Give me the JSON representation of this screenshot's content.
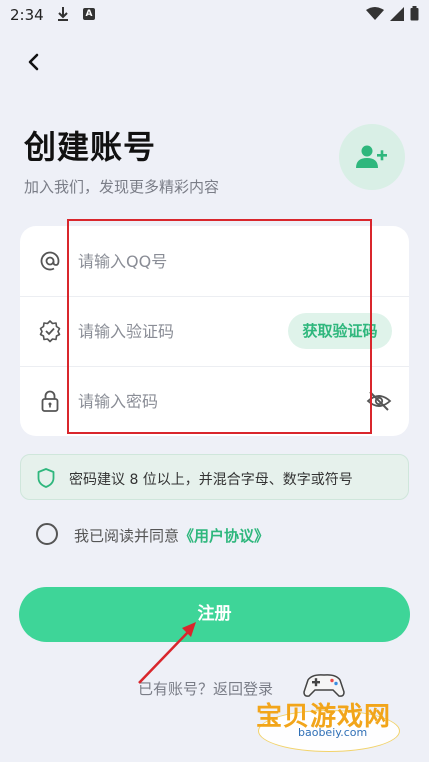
{
  "status_bar": {
    "time": "2:34",
    "a_badge": "A"
  },
  "header": {
    "title": "创建账号",
    "subtitle": "加入我们，发现更多精彩内容"
  },
  "form": {
    "qq_placeholder": "请输入QQ号",
    "code_placeholder": "请输入验证码",
    "get_code_label": "获取验证码",
    "password_placeholder": "请输入密码"
  },
  "tip": {
    "text": "密码建议 8 位以上，并混合字母、数字或符号"
  },
  "agreement": {
    "prefix": "我已阅读并同意",
    "link": "《用户协议》"
  },
  "register_label": "注册",
  "login_prompt": {
    "text": "已有账号？返回登录"
  },
  "watermark": {
    "text": "宝贝游戏网",
    "url": "baobeiy.com"
  },
  "colors": {
    "accent": "#3ed598",
    "accent_text": "#2fb77d",
    "background": "#eef0f7",
    "annotation": "#d9262c"
  },
  "icons": [
    "download-icon",
    "wifi-icon",
    "signal-icon",
    "battery-icon",
    "back-arrow-icon",
    "add-user-icon",
    "at-icon",
    "verified-badge-icon",
    "lock-icon",
    "eye-off-icon",
    "shield-icon"
  ]
}
